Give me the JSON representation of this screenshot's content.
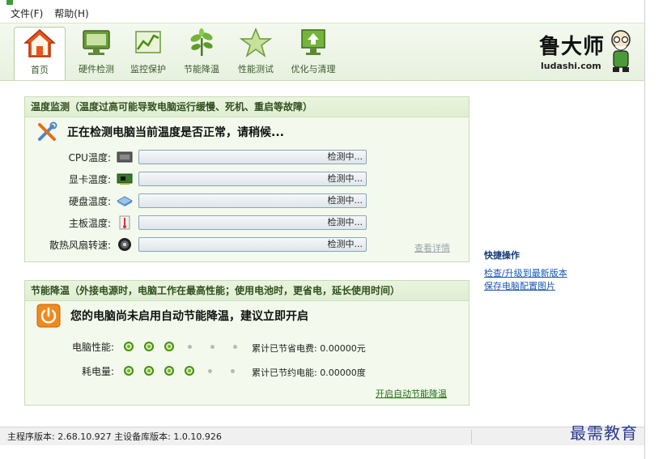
{
  "menubar": {
    "items": [
      "文件(F)",
      "帮助(H)"
    ]
  },
  "tabs": [
    {
      "label": "首页",
      "icon": "home-icon",
      "active": true
    },
    {
      "label": "硬件检测",
      "icon": "monitor-icon"
    },
    {
      "label": "监控保护",
      "icon": "chart-icon"
    },
    {
      "label": "节能降温",
      "icon": "plant-icon"
    },
    {
      "label": "性能测试",
      "icon": "star-icon"
    },
    {
      "label": "优化与清理",
      "icon": "upload-icon"
    }
  ],
  "logo": {
    "title": "鲁大师",
    "site": "ludashi.com"
  },
  "temperature": {
    "title": "温度监测（温度过高可能导致电脑运行缓慢、死机、重启等故障）",
    "headline": "正在检测电脑当前温度是否正常，请稍候...",
    "rows": [
      {
        "label": "CPU温度:",
        "status": "检测中...",
        "icon": "cpu-icon"
      },
      {
        "label": "显卡温度:",
        "status": "检测中...",
        "icon": "gpu-card-icon"
      },
      {
        "label": "硬盘温度:",
        "status": "检测中...",
        "icon": "hard-disk-icon"
      },
      {
        "label": "主板温度:",
        "status": "检测中...",
        "icon": "thermometer-icon"
      },
      {
        "label": "散热风扇转速:",
        "status": "检测中...",
        "icon": "fan-icon"
      }
    ],
    "detail_link": "查看详情"
  },
  "energy": {
    "title": "节能降温（外接电源时，电脑工作在最高性能；使用电池时，更省电，延长使用时间）",
    "headline": "您的电脑尚未启用自动节能降温，建议立即开启",
    "performance": {
      "label": "电脑性能:",
      "level": 3,
      "max": 6
    },
    "power": {
      "label": "耗电量:",
      "level": 4,
      "max": 6
    },
    "saved_cost": "累计已节省电费: 0.00000元",
    "saved_energy": "累计已节约电能: 0.00000度",
    "enable_link": "开启自动节能降温"
  },
  "quick": {
    "title": "快捷操作",
    "links": [
      "检查/升级到最新版本",
      "保存电脑配置图片"
    ]
  },
  "status": {
    "text": "主程序版本: 2.68.10.927  主设备库版本: 1.0.10.926"
  },
  "watermark": "最需教育",
  "colors": {
    "accent": "#3d9a40",
    "panel_bg": "#f3f9ec",
    "link_blue": "#1a56b8",
    "link_green": "#1f6e14",
    "power_orange": "#f08a1c"
  }
}
